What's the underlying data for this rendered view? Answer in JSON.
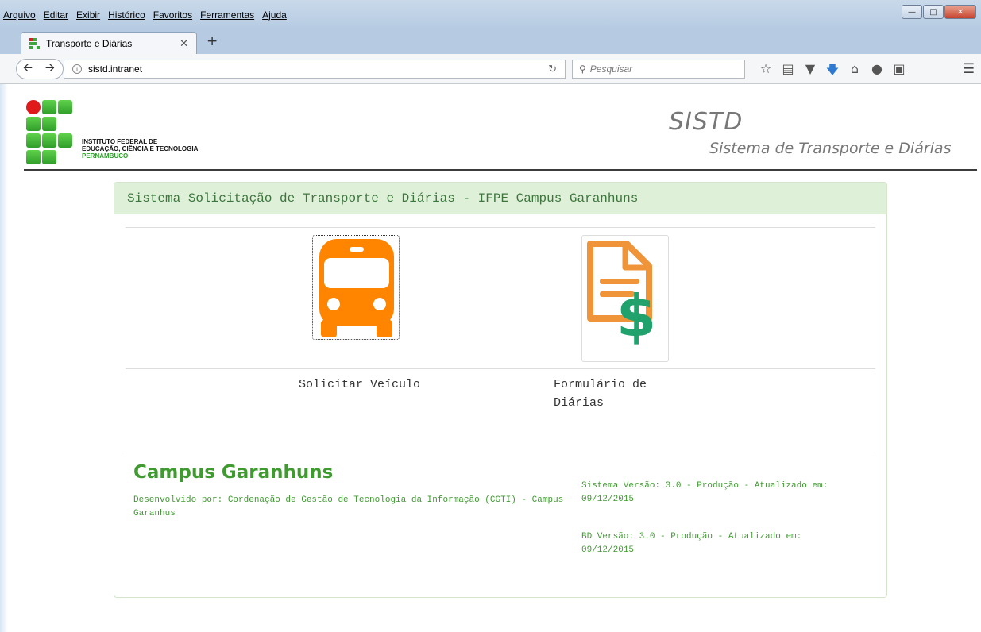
{
  "browser": {
    "menu": [
      "Arquivo",
      "Editar",
      "Exibir",
      "Histórico",
      "Favoritos",
      "Ferramentas",
      "Ajuda"
    ],
    "tab_title": "Transporte e Diárias",
    "url": "sistd.intranet",
    "search_placeholder": "Pesquisar"
  },
  "header": {
    "logo_lines": [
      "INSTITUTO FEDERAL DE",
      "EDUCAÇÃO, CIÊNCIA E TECNOLOGIA",
      "PERNAMBUCO"
    ],
    "brand_title": "SISTD",
    "brand_subtitle": "Sistema de Transporte e Diárias"
  },
  "panel": {
    "heading": "Sistema Solicitação de Transporte e Diárias - IFPE Campus Garanhuns",
    "tiles": [
      {
        "label": "Solicitar Veículo",
        "icon": "bus-icon",
        "color": "#ff8400"
      },
      {
        "label_line1": "Formulário de",
        "label_line2": "Diárias",
        "icon": "document-dollar-icon",
        "color": "#f0943a",
        "accent": "#21a26c"
      }
    ]
  },
  "footer": {
    "campus": "Campus Garanhuns",
    "developed_by": "Desenvolvido por: Cordenação de Gestão de Tecnologia da Informação (CGTI) - Campus Garanhus",
    "system_version_line1": "Sistema Versão: 3.0 - Produção - Atualizado em:",
    "system_version_line2": "09/12/2015",
    "db_version_line1": "BD Versão: 3.0 - Produção - Atualizado em:",
    "db_version_line2": "09/12/2015"
  }
}
